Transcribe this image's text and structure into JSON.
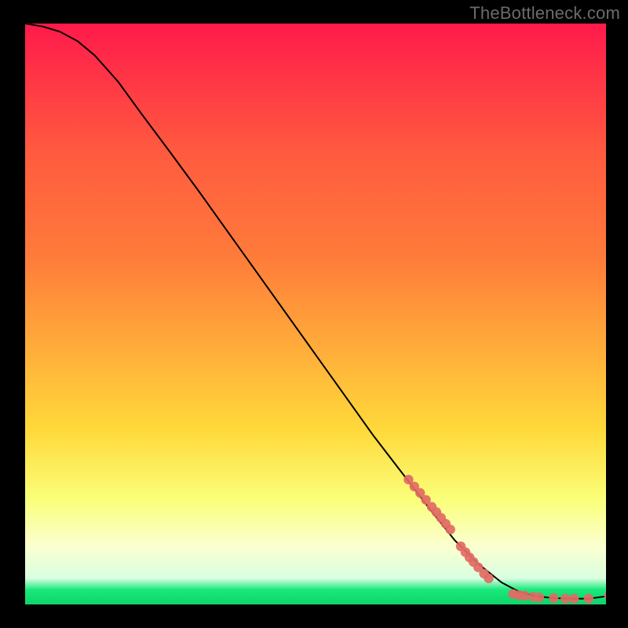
{
  "watermark": "TheBottleneck.com",
  "chart_data": {
    "type": "line",
    "title": "",
    "xlabel": "",
    "ylabel": "",
    "xlim": [
      0,
      100
    ],
    "ylim": [
      0,
      100
    ],
    "grid": false,
    "legend": false,
    "background_gradient": {
      "top_color": "#ff1a4b",
      "mid_upper_color": "#ff7b3a",
      "mid_color": "#ffd93a",
      "mid_lower_color": "#faff7a",
      "lower_color": "#fbffd0",
      "bottom_color": "#18e87a"
    },
    "series": [
      {
        "name": "curve",
        "color": "#000000",
        "x": [
          0,
          3,
          6,
          9,
          12,
          16,
          20,
          25,
          30,
          35,
          40,
          45,
          50,
          55,
          60,
          65,
          70,
          74,
          78,
          82,
          85,
          88,
          91,
          94,
          97,
          100
        ],
        "y": [
          100,
          99.5,
          98.6,
          97,
          94.5,
          90,
          84.5,
          77.8,
          71,
          64,
          57,
          50,
          43,
          36,
          29,
          22.5,
          16,
          11,
          7,
          3.8,
          2.2,
          1.4,
          1.1,
          1.0,
          1.0,
          1.4
        ]
      }
    ],
    "marker_clusters": [
      {
        "name": "cluster-diagonal",
        "color": "#e26a64",
        "points": [
          {
            "x": 66,
            "y": 21.5
          },
          {
            "x": 67,
            "y": 20.3
          },
          {
            "x": 68,
            "y": 19.2
          },
          {
            "x": 69,
            "y": 18.0
          },
          {
            "x": 70,
            "y": 16.8
          },
          {
            "x": 70.8,
            "y": 15.9
          },
          {
            "x": 71.6,
            "y": 14.9
          },
          {
            "x": 72.4,
            "y": 13.9
          },
          {
            "x": 73.2,
            "y": 12.9
          },
          {
            "x": 75,
            "y": 10.0
          },
          {
            "x": 75.8,
            "y": 9.0
          },
          {
            "x": 76.5,
            "y": 8.1
          },
          {
            "x": 77.2,
            "y": 7.3
          },
          {
            "x": 78,
            "y": 6.4
          },
          {
            "x": 79,
            "y": 5.3
          },
          {
            "x": 79.8,
            "y": 4.5
          }
        ]
      },
      {
        "name": "cluster-bottom",
        "color": "#e26a64",
        "points": [
          {
            "x": 84,
            "y": 1.8
          },
          {
            "x": 85,
            "y": 1.6
          },
          {
            "x": 86,
            "y": 1.5
          },
          {
            "x": 87.5,
            "y": 1.3
          },
          {
            "x": 88.5,
            "y": 1.2
          },
          {
            "x": 91,
            "y": 1.1
          },
          {
            "x": 93,
            "y": 1.0
          },
          {
            "x": 94.5,
            "y": 1.0
          },
          {
            "x": 97,
            "y": 1.0
          },
          {
            "x": 100.5,
            "y": 1.5
          }
        ]
      }
    ]
  }
}
